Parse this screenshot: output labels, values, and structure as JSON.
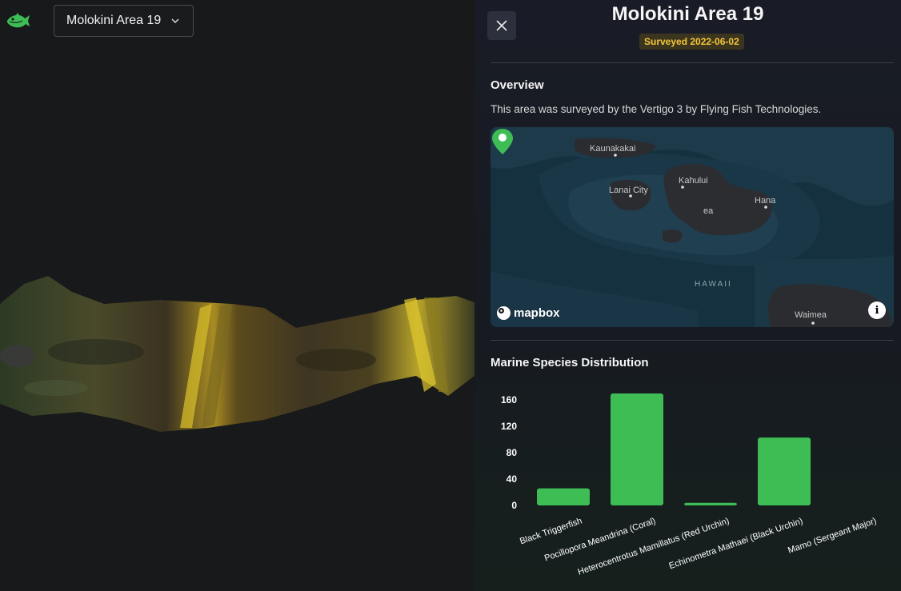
{
  "header": {
    "area_selector": {
      "selected": "Molokini Area 19"
    }
  },
  "panel": {
    "title": "Molokini Area 19",
    "survey_badge": "Surveyed 2022-06-02",
    "overview": {
      "heading": "Overview",
      "text": "This area was surveyed by the Vertigo 3 by Flying Fish Technologies."
    },
    "map": {
      "labels": {
        "kaunakakai": "Kaunakakai",
        "kahului": "Kahului",
        "lanai_city": "Lanai City",
        "kihei": "ea",
        "hana": "Hana",
        "hawaii": "HAWAII",
        "waimea": "Waimea"
      },
      "attribution": "mapbox",
      "info": "i"
    },
    "species": {
      "heading": "Marine Species Distribution"
    }
  },
  "colors": {
    "accent_green": "#3ebd55",
    "badge_bg": "#3b3520",
    "badge_text": "#f3c63a",
    "panel_bg": "#191c26"
  },
  "icons": {
    "logo": "fish-icon",
    "dropdown": "chevron-down-icon",
    "close": "close-icon",
    "map_pin": "map-pin-icon",
    "info": "info-icon"
  },
  "chart_data": {
    "type": "bar",
    "categories": [
      "Black Triggerfish",
      "Pocillopora Meandrina (Coral)",
      "Heterocentrotus Mamillatus (Red Urchin)",
      "Echinometra Mathaei (Black Urchin)",
      "Mamo (Sergeant Major)"
    ],
    "values": [
      26,
      170,
      4,
      103,
      0
    ],
    "yticks": [
      0,
      40,
      80,
      120,
      160
    ],
    "ylim": [
      0,
      170
    ],
    "grid": false,
    "legend": "none",
    "color": "#3ebd55"
  }
}
